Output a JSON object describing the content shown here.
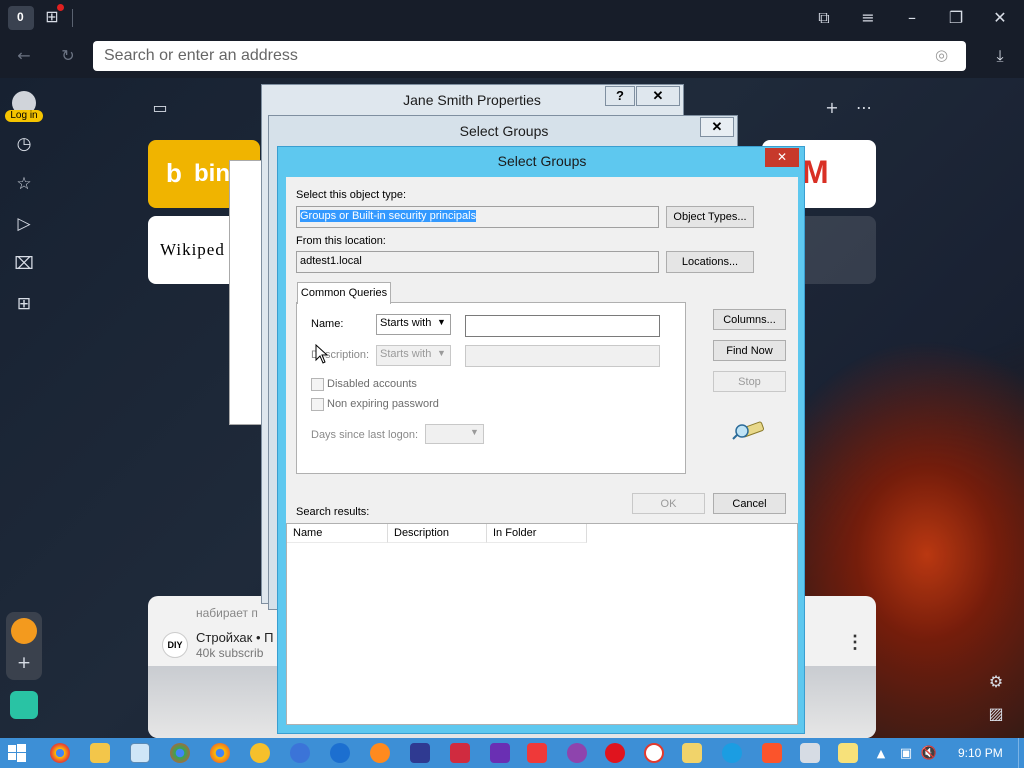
{
  "browser": {
    "tab_count": "0",
    "address_placeholder": "Search or enter an address",
    "login_label": "Log in"
  },
  "tiles": [
    {
      "label": "bin"
    },
    {
      "label": "Wikiped"
    }
  ],
  "feed": {
    "typing": "набирает п",
    "channel": "Стройхак • П",
    "subs": "40k subscrib",
    "avatar": "DIY"
  },
  "windows": {
    "jane_title": "Jane Smith Properties",
    "help": "?",
    "close": "✕",
    "behind_title": "Select Groups"
  },
  "dialog": {
    "title": "Select Groups",
    "object_type_label": "Select this object type:",
    "object_type_value": "Groups or Built-in security principals",
    "object_types_button": "Object Types...",
    "location_label": "From this location:",
    "location_value": "adtest1.local",
    "locations_button": "Locations...",
    "tab_common_queries": "Common Queries",
    "name_label": "Name:",
    "name_mode": "Starts with",
    "description_label": "Description:",
    "description_mode": "Starts with",
    "disabled_accounts": "Disabled accounts",
    "non_expiring": "Non expiring password",
    "days_since": "Days since last logon:",
    "columns_button": "Columns...",
    "find_now_button": "Find Now",
    "stop_button": "Stop",
    "ok_button": "OK",
    "cancel_button": "Cancel",
    "search_results": "Search results:",
    "columns": [
      "Name",
      "Description",
      "In Folder"
    ]
  },
  "taskbar": {
    "time": "9:10 PM"
  }
}
